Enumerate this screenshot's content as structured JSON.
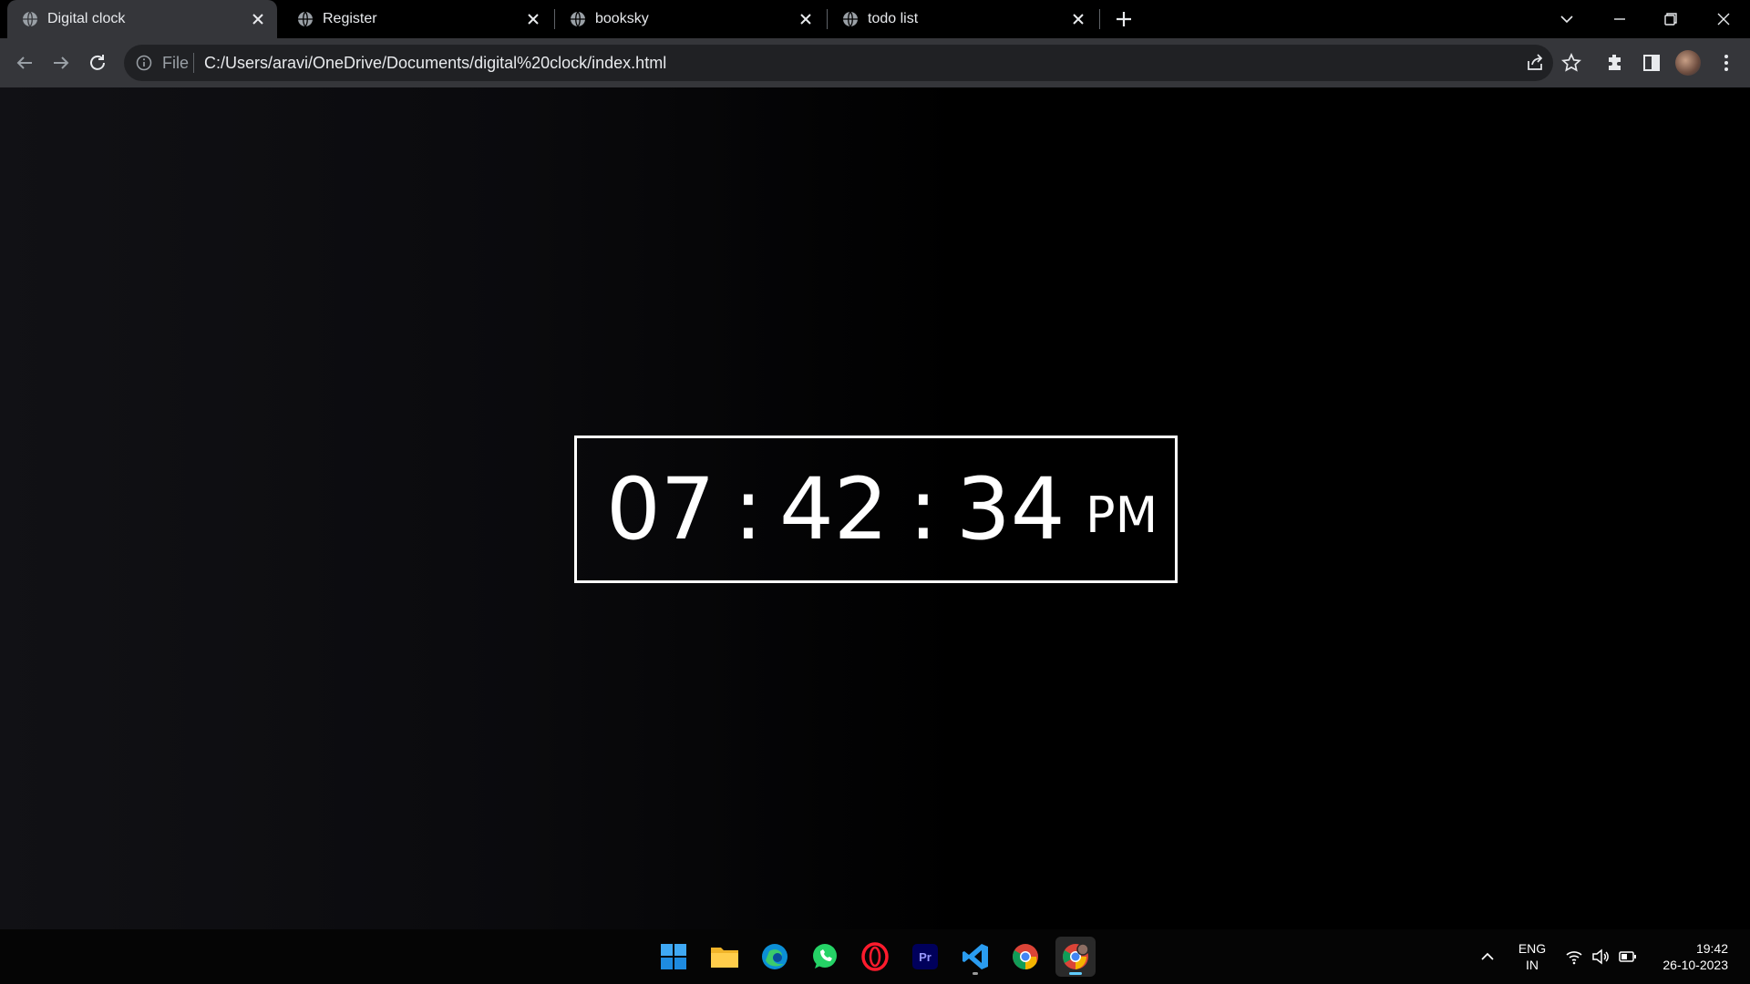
{
  "browser": {
    "tabs": [
      {
        "label": "Digital clock",
        "active": true
      },
      {
        "label": "Register",
        "active": false
      },
      {
        "label": "booksky",
        "active": false
      },
      {
        "label": "todo list",
        "active": false
      }
    ],
    "omnibox": {
      "scheme_label": "File",
      "url": "C:/Users/aravi/OneDrive/Documents/digital%20clock/index.html"
    }
  },
  "clock": {
    "hours": "07",
    "sep1": ":",
    "minutes": "42",
    "sep2": ":",
    "seconds": "34",
    "period": "PM"
  },
  "taskbar": {
    "apps": [
      "start",
      "file-explorer",
      "edge",
      "whatsapp",
      "opera",
      "premiere-pro",
      "vscode",
      "chrome",
      "chrome-canary"
    ],
    "lang_line1": "ENG",
    "lang_line2": "IN",
    "time": "19:42",
    "date": "26-10-2023"
  },
  "colors": {
    "tab_active": "#35363a",
    "toolbar": "#35363a",
    "omnibox": "#202124",
    "clock_text": "#ffffff",
    "accent": "#60cdff"
  }
}
